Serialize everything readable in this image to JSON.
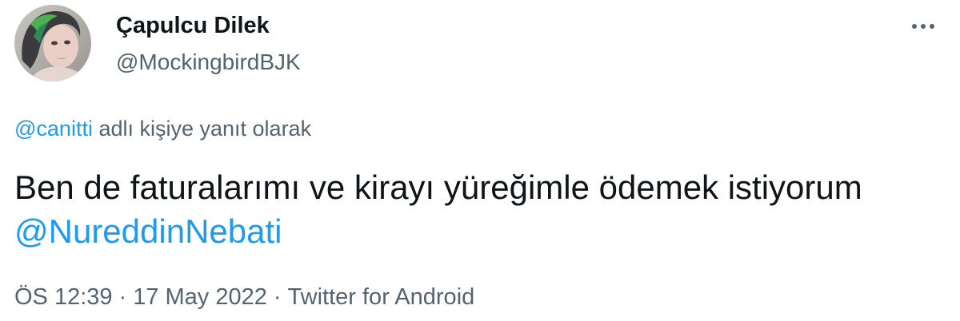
{
  "tweet": {
    "author": {
      "display_name": "Çapulcu Dilek",
      "handle": "@MockingbirdBJK"
    },
    "more_icon": "more-horizontal-icon",
    "reply_context": {
      "mention": "@canitti",
      "text": " adlı kişiye yanıt olarak"
    },
    "body": {
      "text": "Ben de faturalarımı ve kirayı yüreğimle ödemek istiyorum ",
      "mention": "@NureddinNebati"
    },
    "meta": {
      "time": "ÖS 12:39",
      "separator": "·",
      "date": "17 May 2022",
      "source": "Twitter for Android"
    }
  },
  "colors": {
    "text_primary": "#0f1419",
    "text_secondary": "#536471",
    "link": "#1d9bf0",
    "background": "#ffffff"
  }
}
